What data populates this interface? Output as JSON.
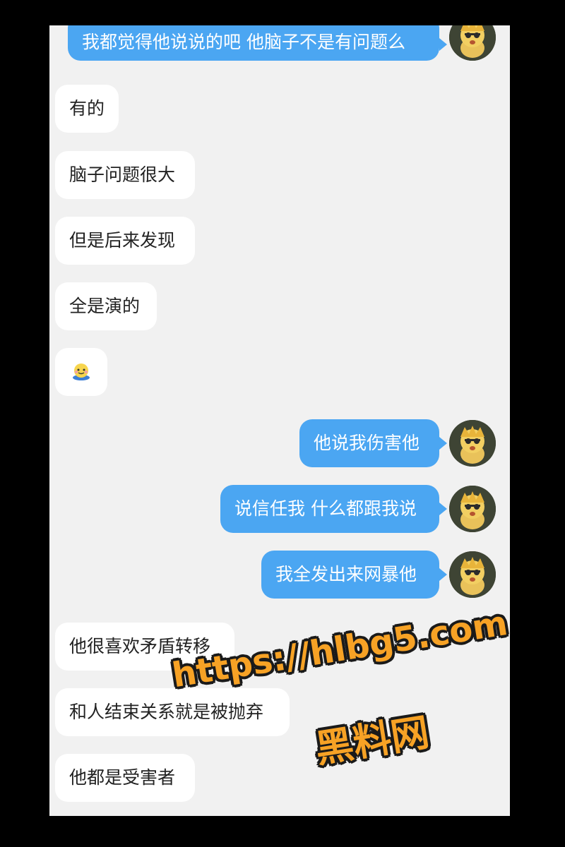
{
  "messages": [
    {
      "side": "out",
      "text": "我都觉得他说说的吧 他脑子不是有问题么"
    },
    {
      "side": "in",
      "text": "有的"
    },
    {
      "side": "in",
      "text": "脑子问题很大"
    },
    {
      "side": "in",
      "text": "但是后来发现"
    },
    {
      "side": "in",
      "text": "全是演的"
    },
    {
      "side": "in",
      "emoji": "smiling-face-sticker"
    },
    {
      "side": "out",
      "text": "他说我伤害他"
    },
    {
      "side": "out",
      "text": "说信任我 什么都跟我说"
    },
    {
      "side": "out",
      "text": "我全发出来网暴他"
    },
    {
      "side": "in",
      "text": "他很喜欢矛盾转移"
    },
    {
      "side": "in",
      "text": "和人结束关系就是被抛弃"
    },
    {
      "side": "in",
      "text": "他都是受害者"
    }
  ],
  "watermark": {
    "url": "https://hlbg5.com",
    "name": "黑料网"
  },
  "colors": {
    "outgoing_bubble": "#4ba6f2",
    "incoming_bubble": "#ffffff",
    "chat_background": "#f1f1f1",
    "watermark": "#f7a225"
  },
  "icons": {
    "avatar": "yellow-cartoon-avatar-icon",
    "emoji": "smiling-face-sticker"
  }
}
